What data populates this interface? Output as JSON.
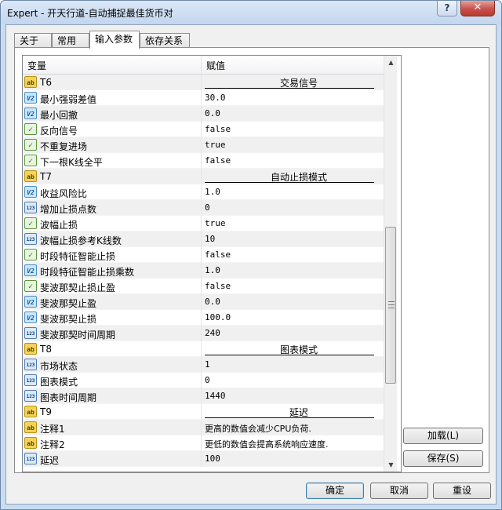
{
  "window": {
    "title": "Expert - 开天行道-自动捕捉最佳货币对",
    "help_label": "?",
    "close_label": "✕"
  },
  "tabs": [
    {
      "label": "关于"
    },
    {
      "label": "常用"
    },
    {
      "label": "输入参数"
    },
    {
      "label": "依存关系"
    }
  ],
  "table": {
    "col_name": "变量",
    "col_value": "赋值",
    "rows": [
      {
        "icon": "ab",
        "name": "T6",
        "value": "交易信号",
        "is_separator": true
      },
      {
        "icon": "v2",
        "name": "最小强弱差值",
        "value": "30.0"
      },
      {
        "icon": "v2",
        "name": "最小回撤",
        "value": "0.0"
      },
      {
        "icon": "bool",
        "name": "反向信号",
        "value": "false"
      },
      {
        "icon": "bool",
        "name": "不重复进场",
        "value": "true"
      },
      {
        "icon": "bool",
        "name": "下一根K线全平",
        "value": "false"
      },
      {
        "icon": "ab",
        "name": "T7",
        "value": "自动止损模式",
        "is_separator": true
      },
      {
        "icon": "v2",
        "name": "收益风险比",
        "value": "1.0"
      },
      {
        "icon": "n123",
        "name": "增加止损点数",
        "value": "0"
      },
      {
        "icon": "bool",
        "name": "波幅止损",
        "value": "true"
      },
      {
        "icon": "n123",
        "name": "波幅止损参考K线数",
        "value": "10"
      },
      {
        "icon": "bool",
        "name": "时段特征智能止损",
        "value": "false"
      },
      {
        "icon": "v2",
        "name": "时段特征智能止损乘数",
        "value": "1.0"
      },
      {
        "icon": "bool",
        "name": "斐波那契止损止盈",
        "value": "false"
      },
      {
        "icon": "v2",
        "name": "斐波那契止盈",
        "value": "0.0"
      },
      {
        "icon": "v2",
        "name": "斐波那契止损",
        "value": "100.0"
      },
      {
        "icon": "n123",
        "name": "斐波那契时间周期",
        "value": "240"
      },
      {
        "icon": "ab",
        "name": "T8",
        "value": "图表模式",
        "is_separator": true
      },
      {
        "icon": "n123",
        "name": "市场状态",
        "value": "1"
      },
      {
        "icon": "n123",
        "name": "图表模式",
        "value": "0"
      },
      {
        "icon": "n123",
        "name": "图表时间周期",
        "value": "1440"
      },
      {
        "icon": "ab",
        "name": "T9",
        "value": "延迟",
        "is_separator": true
      },
      {
        "icon": "ab",
        "name": "注释1",
        "value": "更高的数值会减少CPU负荷.",
        "is_text": true
      },
      {
        "icon": "ab",
        "name": "注释2",
        "value": "更低的数值会提高系统响应速度.",
        "is_text": true
      },
      {
        "icon": "n123",
        "name": "延迟",
        "value": "100"
      }
    ]
  },
  "side_buttons": {
    "load": "加载(L)",
    "save": "保存(S)"
  },
  "footer_buttons": {
    "ok": "确定",
    "cancel": "取消",
    "reset": "重设"
  },
  "icon_glyphs": {
    "ab": "ab",
    "v2": "V2",
    "n123": "123",
    "bool": "✓"
  }
}
